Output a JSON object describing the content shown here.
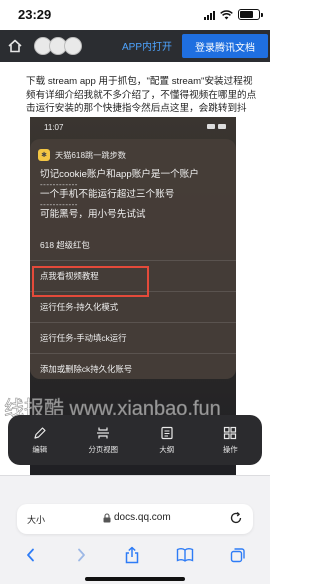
{
  "status_bar": {
    "time": "23:29"
  },
  "header": {
    "open_app_label": "APP内打开",
    "login_label": "登录腾讯文档"
  },
  "doc": {
    "lines": [
      "下载 stream app 用于抓包，\"配置 stream\"安装过程视",
      "频有详细介绍我就不多介绍了，不懂得视频在哪里的点",
      "击运行安装的那个快捷指令然后点这里，会跳转到抖"
    ]
  },
  "embed": {
    "time": "11:07",
    "shortcut_title": "天猫618跳一跳步数",
    "message_lines": [
      "切记cookie账户和app账户是一个账户",
      "------------",
      "一个手机不能运行超过三个账号",
      "------------",
      "可能黑号，用小号先试试"
    ],
    "menu_items": [
      "618 超级红包",
      "点我看视频教程",
      "运行任务-持久化模式",
      "运行任务-手动填ck运行",
      "添加或删除ck持久化账号"
    ]
  },
  "watermark": {
    "text": "线报酷 www.xianbao.fun"
  },
  "toolbar": {
    "items": [
      {
        "label": "编辑",
        "icon": "pencil-icon"
      },
      {
        "label": "分页视图",
        "icon": "page-view-icon"
      },
      {
        "label": "大纲",
        "icon": "outline-icon"
      },
      {
        "label": "操作",
        "icon": "grid-icon"
      }
    ]
  },
  "safari": {
    "aa_label": "大小",
    "url": "docs.qq.com"
  }
}
